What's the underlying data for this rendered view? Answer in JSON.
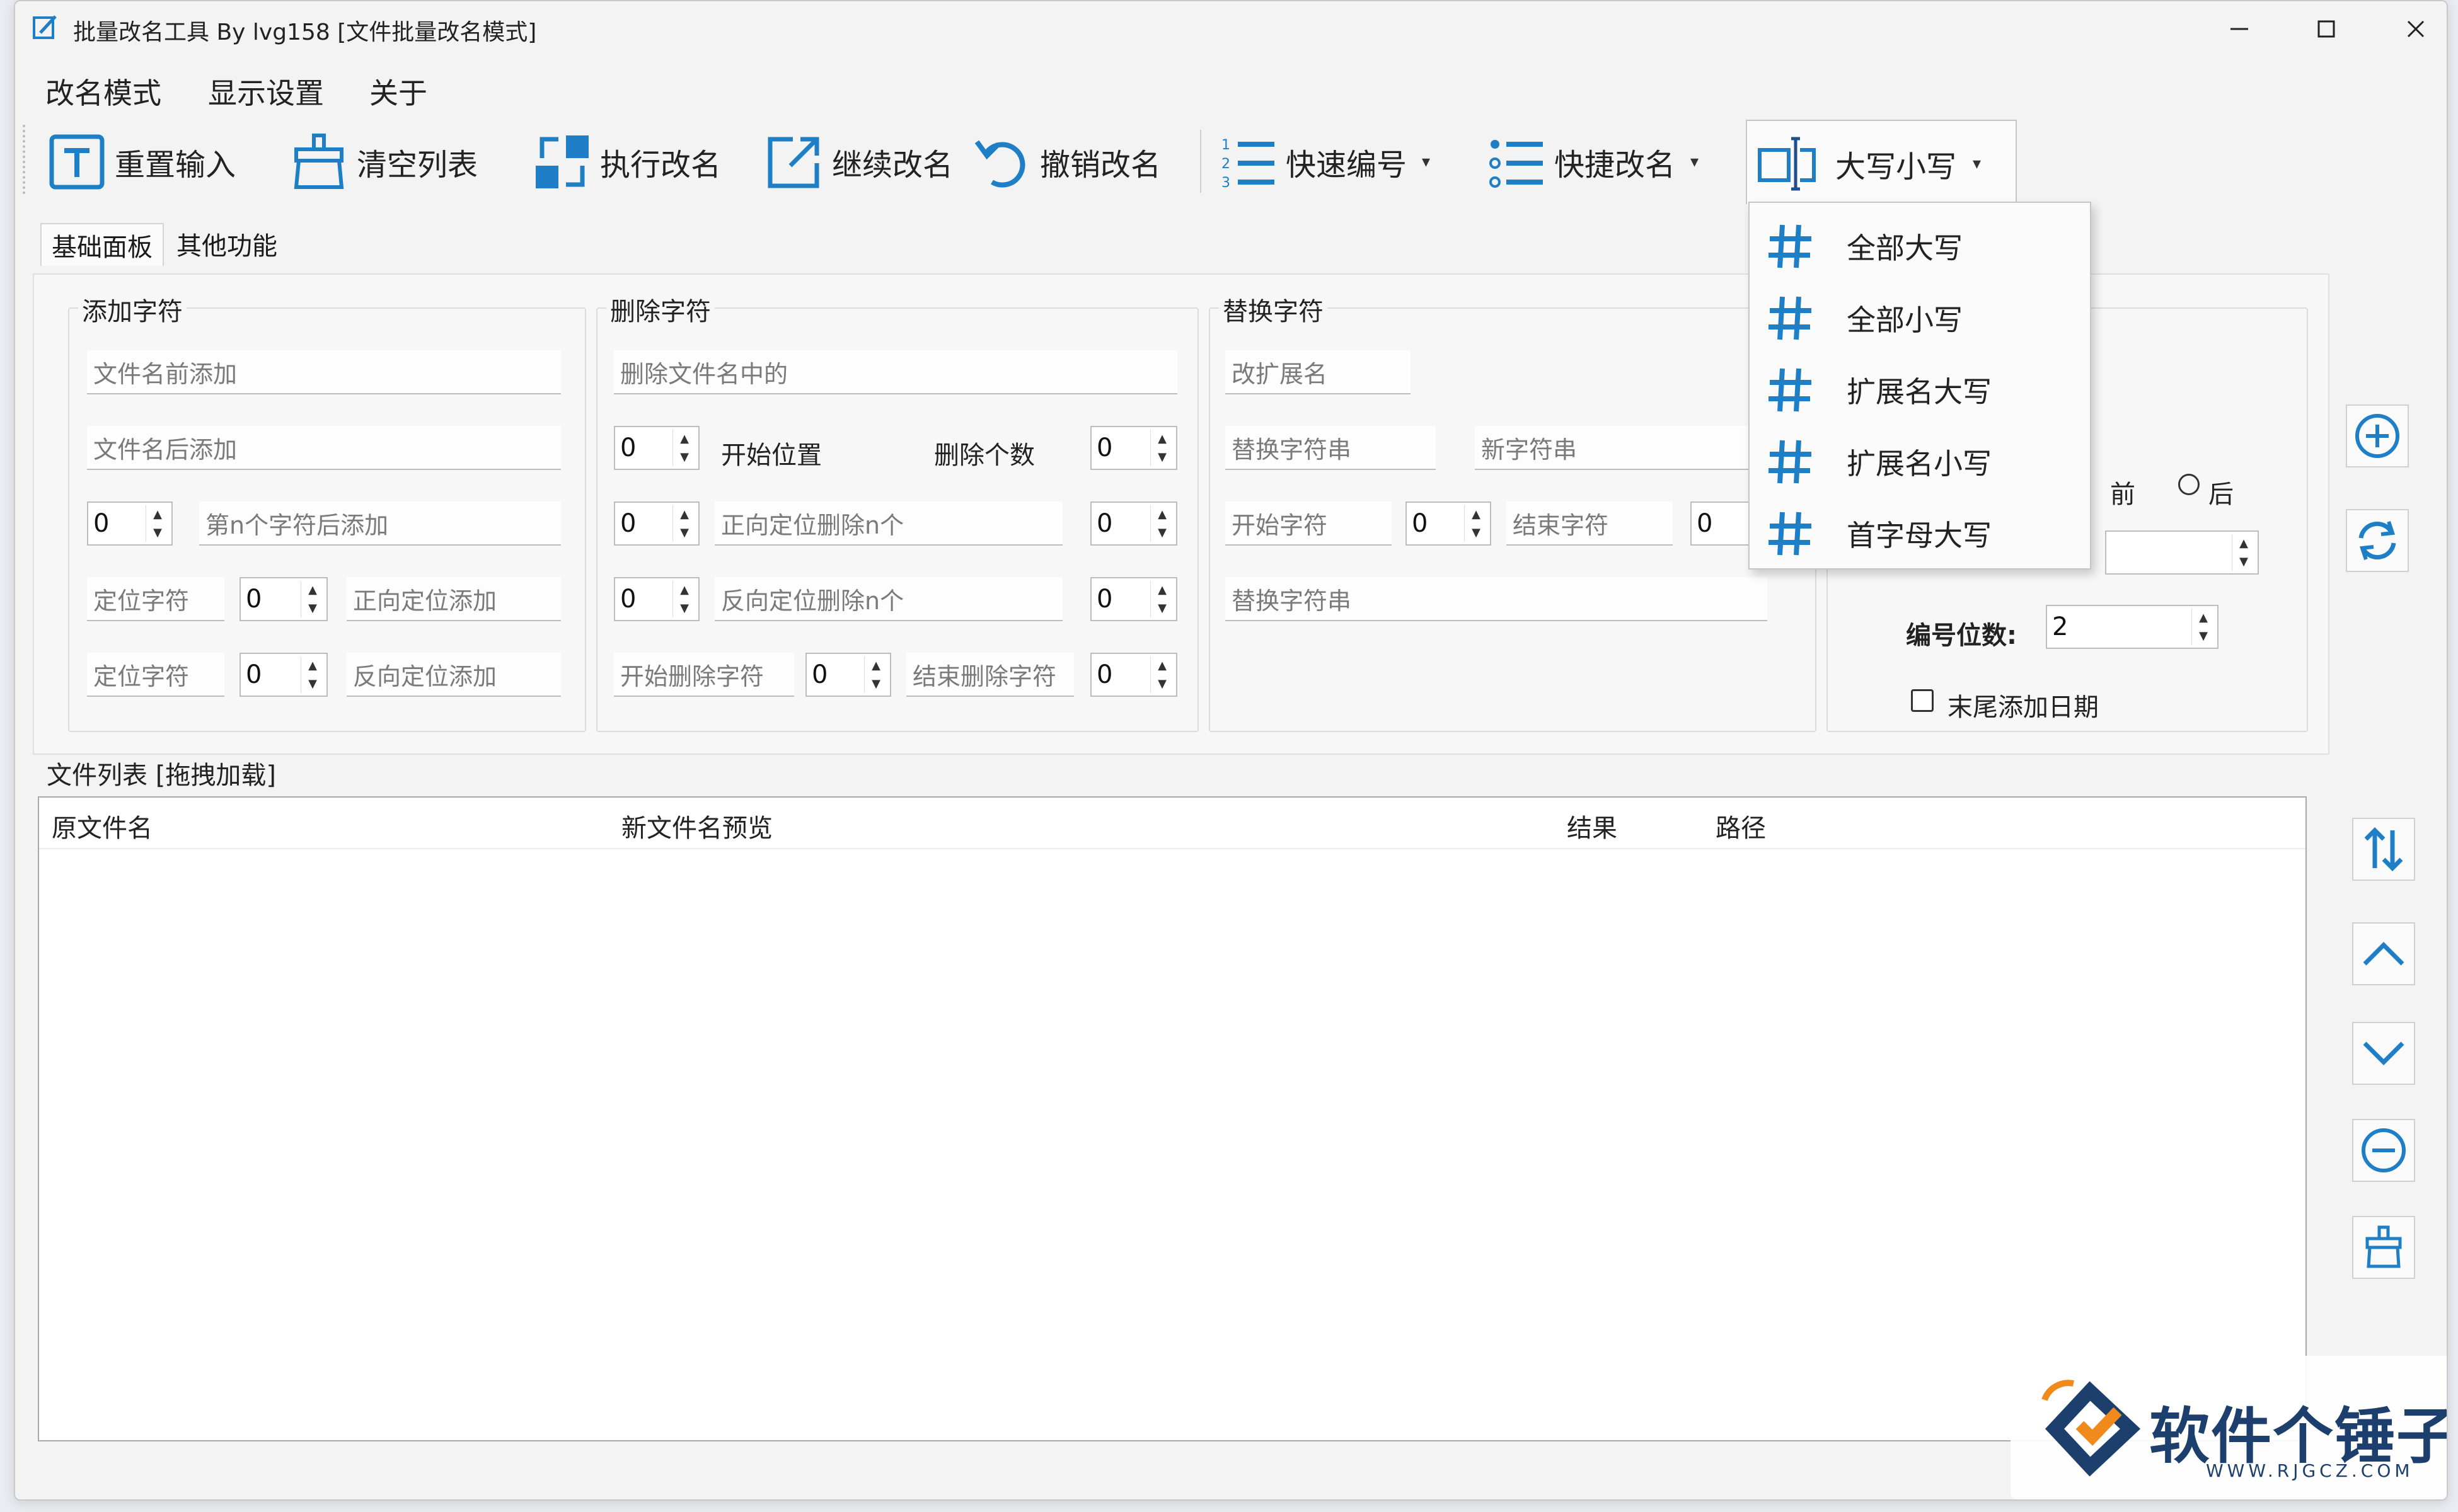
{
  "window": {
    "title": "批量改名工具 By lvg158  [文件批量改名模式]",
    "accent": "#1e7fc7"
  },
  "menubar": {
    "items": [
      "改名模式",
      "显示设置",
      "关于"
    ]
  },
  "toolbar": {
    "reset_input": "重置输入",
    "clear_list": "清空列表",
    "execute_rename": "执行改名",
    "continue_rename": "继续改名",
    "undo_rename": "撤销改名",
    "quick_number": "快速编号",
    "quick_rename": "快捷改名",
    "case_convert": "大写小写"
  },
  "case_menu": {
    "items": [
      "全部大写",
      "全部小写",
      "扩展名大写",
      "扩展名小写",
      "首字母大写"
    ]
  },
  "tabs": [
    "基础面板",
    "其他功能"
  ],
  "add_chars": {
    "title": "添加字符",
    "prefix_placeholder": "文件名前添加",
    "suffix_placeholder": "文件名后添加",
    "nth_value": "0",
    "nth_placeholder": "第n个字符后添加",
    "locate1_placeholder": "定位字符",
    "locate1_value": "0",
    "forward_add": "正向定位添加",
    "locate2_placeholder": "定位字符",
    "locate2_value": "0",
    "reverse_add": "反向定位添加"
  },
  "delete_chars": {
    "title": "删除字符",
    "contains_placeholder": "删除文件名中的",
    "start_value": "0",
    "start_label": "开始位置",
    "count_label": "删除个数",
    "count_value": "0",
    "fwd_value": "0",
    "fwd_placeholder": "正向定位删除n个",
    "fwd_n": "0",
    "rev_value": "0",
    "rev_placeholder": "反向定位删除n个",
    "rev_n": "0",
    "start_del_placeholder": "开始删除字符",
    "mid_value": "0",
    "end_del_placeholder": "结束删除字符",
    "end_value": "0"
  },
  "replace_chars": {
    "title": "替换字符",
    "ext_placeholder": "改扩展名",
    "find_placeholder": "替换字符串",
    "new_placeholder": "新字符串",
    "start_char_placeholder": "开始字符",
    "start_value": "0",
    "end_char_placeholder": "结束字符",
    "end_value": "0",
    "replace_str_placeholder": "替换字符串"
  },
  "numbering": {
    "before_label": "前",
    "after_label": "后",
    "digits_label": "编号位数:",
    "digits_value": "2",
    "add_date_label": "末尾添加日期"
  },
  "file_list": {
    "label": "文件列表  [拖拽加载]",
    "columns": [
      "原文件名",
      "新文件名预览",
      "结果",
      "路径"
    ]
  },
  "watermark": {
    "text": "软件个锤子",
    "url": "WWW.RJGCZ.COM"
  }
}
